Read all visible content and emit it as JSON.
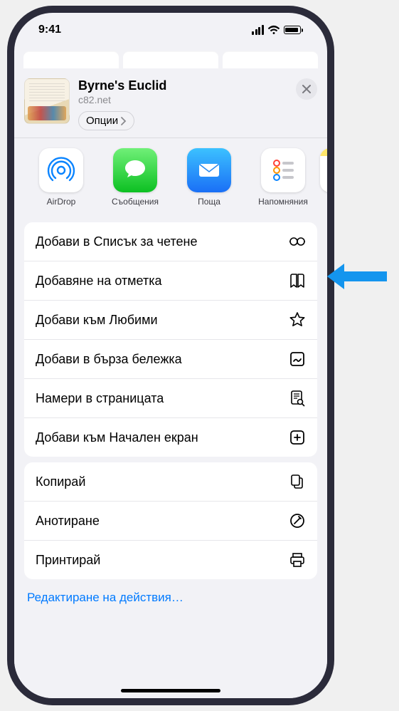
{
  "status": {
    "time": "9:41"
  },
  "header": {
    "title": "Byrne's Euclid",
    "subtitle": "c82.net",
    "options_label": "Опции"
  },
  "apps": [
    {
      "label": "AirDrop",
      "icon": "airdrop"
    },
    {
      "label": "Съобщения",
      "icon": "messages"
    },
    {
      "label": "Поща",
      "icon": "mail"
    },
    {
      "label": "Напомняния",
      "icon": "reminders"
    },
    {
      "label": "",
      "icon": "notes"
    }
  ],
  "actions_group1": [
    {
      "label": "Добави в Списък за четене",
      "icon": "reading-list"
    },
    {
      "label": "Добавяне на отметка",
      "icon": "bookmark"
    },
    {
      "label": "Добави към Любими",
      "icon": "star"
    },
    {
      "label": "Добави в бърза бележка",
      "icon": "quick-note"
    },
    {
      "label": "Намери в страницата",
      "icon": "find"
    },
    {
      "label": "Добави към Начален екран",
      "icon": "home-screen"
    }
  ],
  "actions_group2": [
    {
      "label": "Копирай",
      "icon": "copy"
    },
    {
      "label": "Анотиране",
      "icon": "markup"
    },
    {
      "label": "Принтирай",
      "icon": "print"
    }
  ],
  "edit_actions_label": "Редактиране на действия…"
}
